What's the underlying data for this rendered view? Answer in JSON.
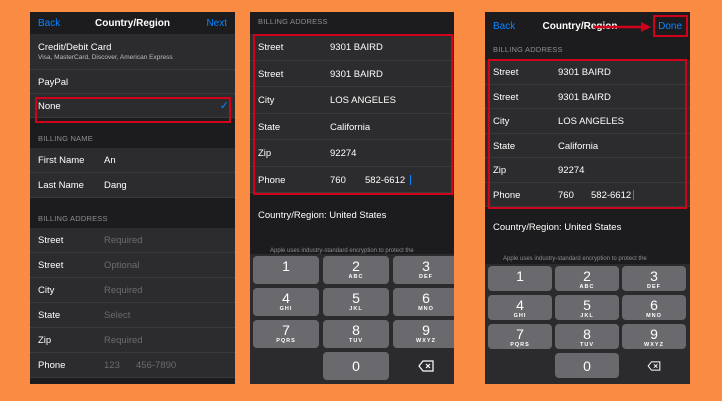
{
  "panel1": {
    "nav": {
      "back": "Back",
      "title": "Country/Region",
      "next": "Next"
    },
    "payment_methods": [
      {
        "label": "Credit/Debit Card",
        "sub": "Visa, MasterCard, Discover, American Express"
      },
      {
        "label": "PayPal"
      },
      {
        "label": "None",
        "selected": true
      }
    ],
    "billing_name_header": "BILLING NAME",
    "billing_name": [
      {
        "label": "First Name",
        "value": "An"
      },
      {
        "label": "Last Name",
        "value": "Dang"
      }
    ],
    "billing_address_header": "BILLING ADDRESS",
    "billing_address": [
      {
        "label": "Street",
        "placeholder": "Required"
      },
      {
        "label": "Street",
        "placeholder": "Optional"
      },
      {
        "label": "City",
        "placeholder": "Required"
      },
      {
        "label": "State",
        "placeholder": "Select"
      },
      {
        "label": "Zip",
        "placeholder": "Required"
      },
      {
        "label": "Phone",
        "placeholder_area": "123",
        "placeholder_number": "456-7890"
      }
    ]
  },
  "panel2": {
    "billing_address_header": "BILLING ADDRESS",
    "fields": [
      {
        "label": "Street",
        "value": "9301 BAIRD"
      },
      {
        "label": "Street",
        "value": "9301 BAIRD"
      },
      {
        "label": "City",
        "value": "LOS ANGELES"
      },
      {
        "label": "State",
        "value": "California"
      },
      {
        "label": "Zip",
        "value": "92274"
      },
      {
        "label": "Phone",
        "area": "760",
        "number": "582-6612"
      }
    ],
    "country": "Country/Region: United States",
    "encryption_note": "Apple uses industry-standard encryption to protect the"
  },
  "panel3": {
    "nav": {
      "back": "Back",
      "title": "Country/Region",
      "done": "Done"
    },
    "billing_address_header": "BILLING ADDRESS",
    "fields": [
      {
        "label": "Street",
        "value": "9301 BAIRD"
      },
      {
        "label": "Street",
        "value": "9301 BAIRD"
      },
      {
        "label": "City",
        "value": "LOS ANGELES"
      },
      {
        "label": "State",
        "value": "California"
      },
      {
        "label": "Zip",
        "value": "92274"
      },
      {
        "label": "Phone",
        "area": "760",
        "number": "582-6612"
      }
    ],
    "country": "Country/Region: United States",
    "encryption_note": "Apple uses industry-standard encryption to protect the"
  },
  "keypad": [
    {
      "n": "1",
      "l": ""
    },
    {
      "n": "2",
      "l": "ABC"
    },
    {
      "n": "3",
      "l": "DEF"
    },
    {
      "n": "4",
      "l": "GHI"
    },
    {
      "n": "5",
      "l": "JKL"
    },
    {
      "n": "6",
      "l": "MNO"
    },
    {
      "n": "7",
      "l": "PQRS"
    },
    {
      "n": "8",
      "l": "TUV"
    },
    {
      "n": "9",
      "l": "WXYZ"
    },
    {
      "n": "0",
      "l": ""
    }
  ],
  "colors": {
    "background": "#F98B42",
    "accent": "#0A84FF",
    "highlight": "#D0021B",
    "screen": "#1C1C1E"
  }
}
